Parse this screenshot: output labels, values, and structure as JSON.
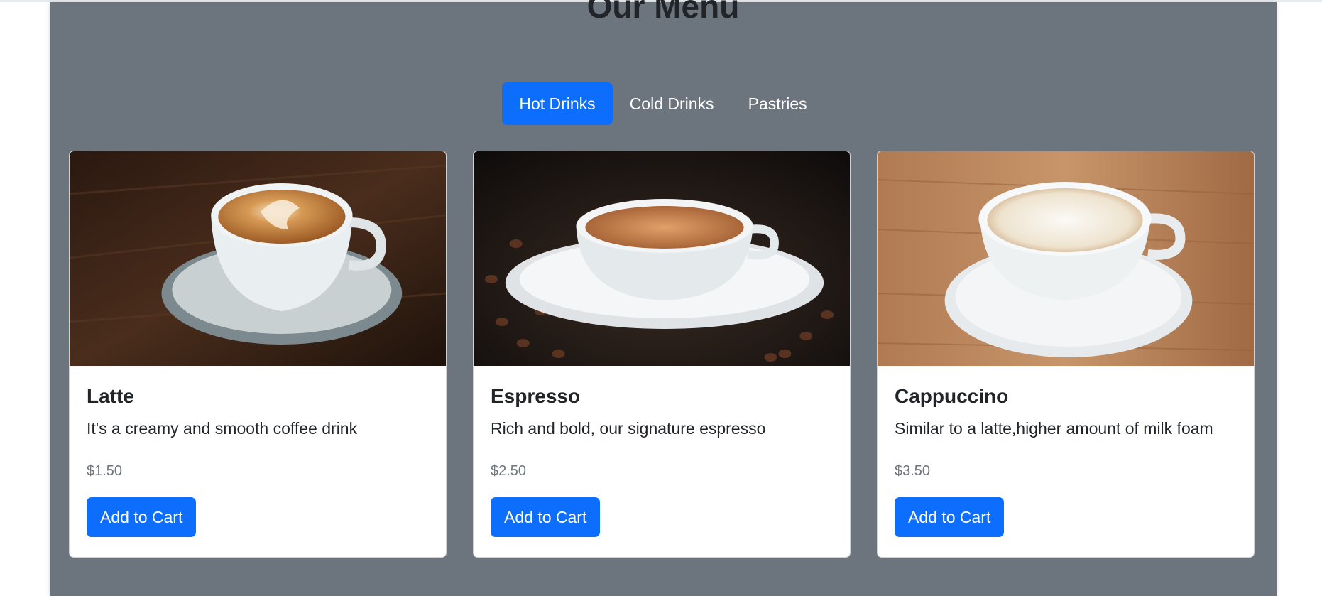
{
  "page": {
    "title": "Our Menu"
  },
  "tabs": [
    {
      "label": "Hot Drinks",
      "active": true
    },
    {
      "label": "Cold Drinks",
      "active": false
    },
    {
      "label": "Pastries",
      "active": false
    }
  ],
  "products": [
    {
      "name": "Latte",
      "description": "It's a creamy and smooth coffee drink",
      "price": "$1.50",
      "button_label": "Add to Cart",
      "image": "latte-photo"
    },
    {
      "name": "Espresso",
      "description": "Rich and bold, our signature espresso",
      "price": "$2.50",
      "button_label": "Add to Cart",
      "image": "espresso-photo"
    },
    {
      "name": "Cappuccino",
      "description": "Similar to a latte,higher amount of milk foam",
      "price": "$3.50",
      "button_label": "Add to Cart",
      "image": "cappuccino-photo"
    }
  ],
  "colors": {
    "panel_bg": "#6c757d",
    "accent": "#0d6efd",
    "text_dark": "#212529",
    "text_muted": "#6c757d"
  }
}
